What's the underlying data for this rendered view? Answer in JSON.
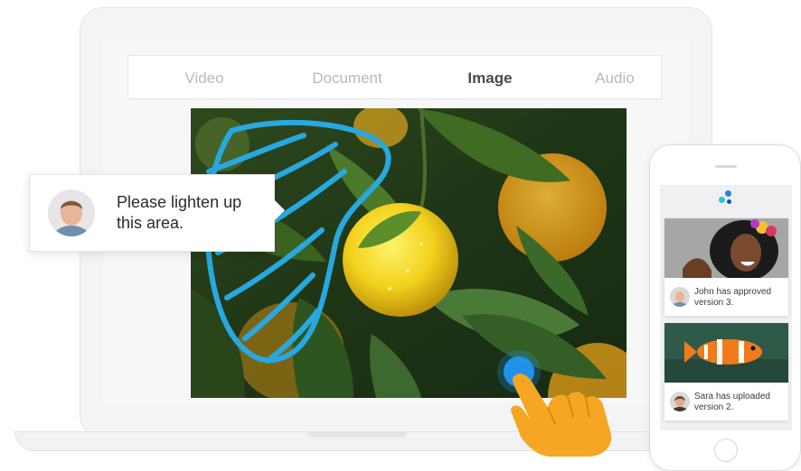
{
  "tabs": [
    {
      "label": "Video",
      "active": false
    },
    {
      "label": "Document",
      "active": false
    },
    {
      "label": "Image",
      "active": true
    },
    {
      "label": "Audio",
      "active": false
    }
  ],
  "comment": {
    "text": "Please lighten up this area.",
    "annotation_color": "#27a8e0"
  },
  "phone": {
    "logo_colors": [
      "#27c4d8",
      "#2b7fd6",
      "#1b4fa0"
    ],
    "cards": [
      {
        "activity": "John has approved version 3.",
        "image": "smiling-woman-photo"
      },
      {
        "activity": "Sara has uploaded version 2.",
        "image": "clownfish-photo"
      }
    ]
  },
  "colors": {
    "accent_blue": "#27a8e0",
    "hand_orange": "#f5a623",
    "touch_dot": "#2196f3"
  }
}
